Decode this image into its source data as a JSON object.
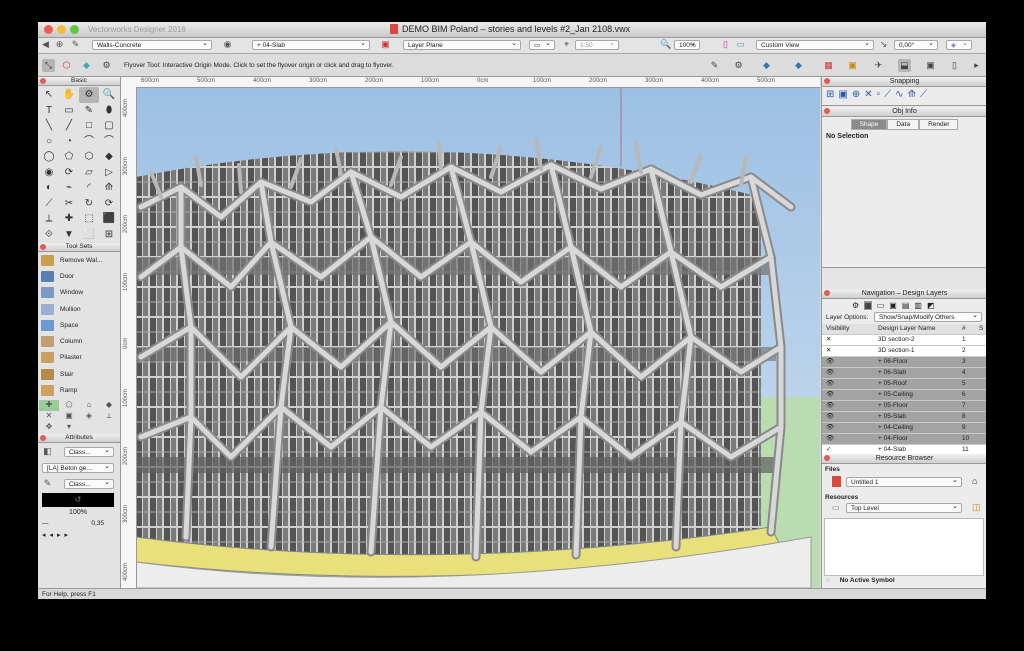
{
  "window": {
    "app_name": "Vectorworks Designer 2016",
    "doc_title": "DEMO BIM Poland – stories and levels #2_Jan 2108.vwx"
  },
  "toolbar": {
    "class_select": "Walls-Concrete",
    "layer_select": "+ 04-Slab",
    "plane_select": "Layer Plane",
    "scale": "1:50",
    "zoom": "100%",
    "view_select": "Custom View",
    "rotation": "0,00°"
  },
  "mode_bar": {
    "hint": "Flyover Tool: Interactive Origin Mode. Click to set the flyover origin or click and drag to flyover."
  },
  "basic_palette": {
    "title": "Basic",
    "tools": [
      "↖",
      "✋",
      "⚙",
      "🔍",
      "T",
      "▭",
      "✎",
      "⬮",
      "╲",
      "╱",
      "□",
      "▢",
      "○",
      "◔",
      "⌒",
      "⌒",
      "◯",
      "⬠",
      "⬡",
      "◆",
      "◉",
      "⟳",
      "▱",
      "▷",
      "◐",
      "⌁",
      "◜",
      "⟰",
      "⟋",
      "✂",
      "↻",
      "⟳",
      "⟂",
      "✚",
      "⬚",
      "⬛",
      "⟐",
      "▼",
      "⬜",
      "⊞"
    ]
  },
  "tool_sets": {
    "title": "Tool Sets",
    "items": [
      {
        "label": "Remove Wal...",
        "color": "#c8a050"
      },
      {
        "label": "Door",
        "color": "#5b7fb0"
      },
      {
        "label": "Window",
        "color": "#7a9ac4"
      },
      {
        "label": "Mullion",
        "color": "#9ab0d0"
      },
      {
        "label": "Space",
        "color": "#6a9ad0"
      },
      {
        "label": "Column",
        "color": "#c0a070"
      },
      {
        "label": "Pilaster",
        "color": "#c8a060"
      },
      {
        "label": "Stair",
        "color": "#b88a4a"
      },
      {
        "label": "Ramp",
        "color": "#d0a060"
      }
    ]
  },
  "attributes": {
    "title": "Attributes",
    "class1": "Class...",
    "fill": "[LA] Beton ge...",
    "class2": "Class...",
    "opacity": "100%",
    "line_weight": "0,35"
  },
  "snapping": {
    "title": "Snapping"
  },
  "obj_info": {
    "title": "Obj Info",
    "tabs": [
      "Shape",
      "Data",
      "Render"
    ],
    "selection": "No Selection"
  },
  "navigation": {
    "title": "Navigation – Design Layers",
    "layer_options_label": "Layer Options:",
    "layer_options_value": "Show/Snap/Modify Others",
    "columns": [
      "Visibility",
      "Design Layer Name",
      "#",
      "S"
    ],
    "rows": [
      {
        "vis": "✕",
        "name": "3D section-2",
        "num": "1",
        "style": "vis"
      },
      {
        "vis": "✕",
        "name": "3D section-1",
        "num": "2",
        "style": "vis"
      },
      {
        "vis": "👁",
        "name": "+ 06-Floor",
        "num": "3",
        "style": "dark"
      },
      {
        "vis": "👁",
        "name": "+ 06-Slab",
        "num": "4",
        "style": "dark"
      },
      {
        "vis": "👁",
        "name": "+ 05-Roof",
        "num": "5",
        "style": "dark"
      },
      {
        "vis": "👁",
        "name": "+ 05-Ceiling",
        "num": "6",
        "style": "dark"
      },
      {
        "vis": "👁",
        "name": "+ 05-Floor",
        "num": "7",
        "style": "dark"
      },
      {
        "vis": "👁",
        "name": "+ 05-Slab",
        "num": "8",
        "style": "dark"
      },
      {
        "vis": "👁",
        "name": "+ 04-Ceiling",
        "num": "9",
        "style": "dark"
      },
      {
        "vis": "👁",
        "name": "+ 04-Floor",
        "num": "10",
        "style": "dark"
      },
      {
        "vis": "✓",
        "name": "+ 04-Slab",
        "num": "11",
        "style": "vis"
      }
    ]
  },
  "resource_browser": {
    "title": "Resource Browser",
    "files_label": "Files",
    "file_value": "Untitled 1",
    "resources_label": "Resources",
    "resources_value": "Top Level",
    "active_symbol": "No Active Symbol"
  },
  "rulers": {
    "top": [
      "600cm",
      "500cm",
      "400cm",
      "300cm",
      "200cm",
      "100cm",
      "0cm",
      "100cm",
      "200cm",
      "300cm",
      "400cm",
      "500cm"
    ],
    "left": [
      "400cm",
      "300cm",
      "200cm",
      "100cm",
      "0cm",
      "100cm",
      "200cm",
      "300cm",
      "400cm"
    ]
  },
  "status": {
    "text": "For Help, press F1"
  }
}
